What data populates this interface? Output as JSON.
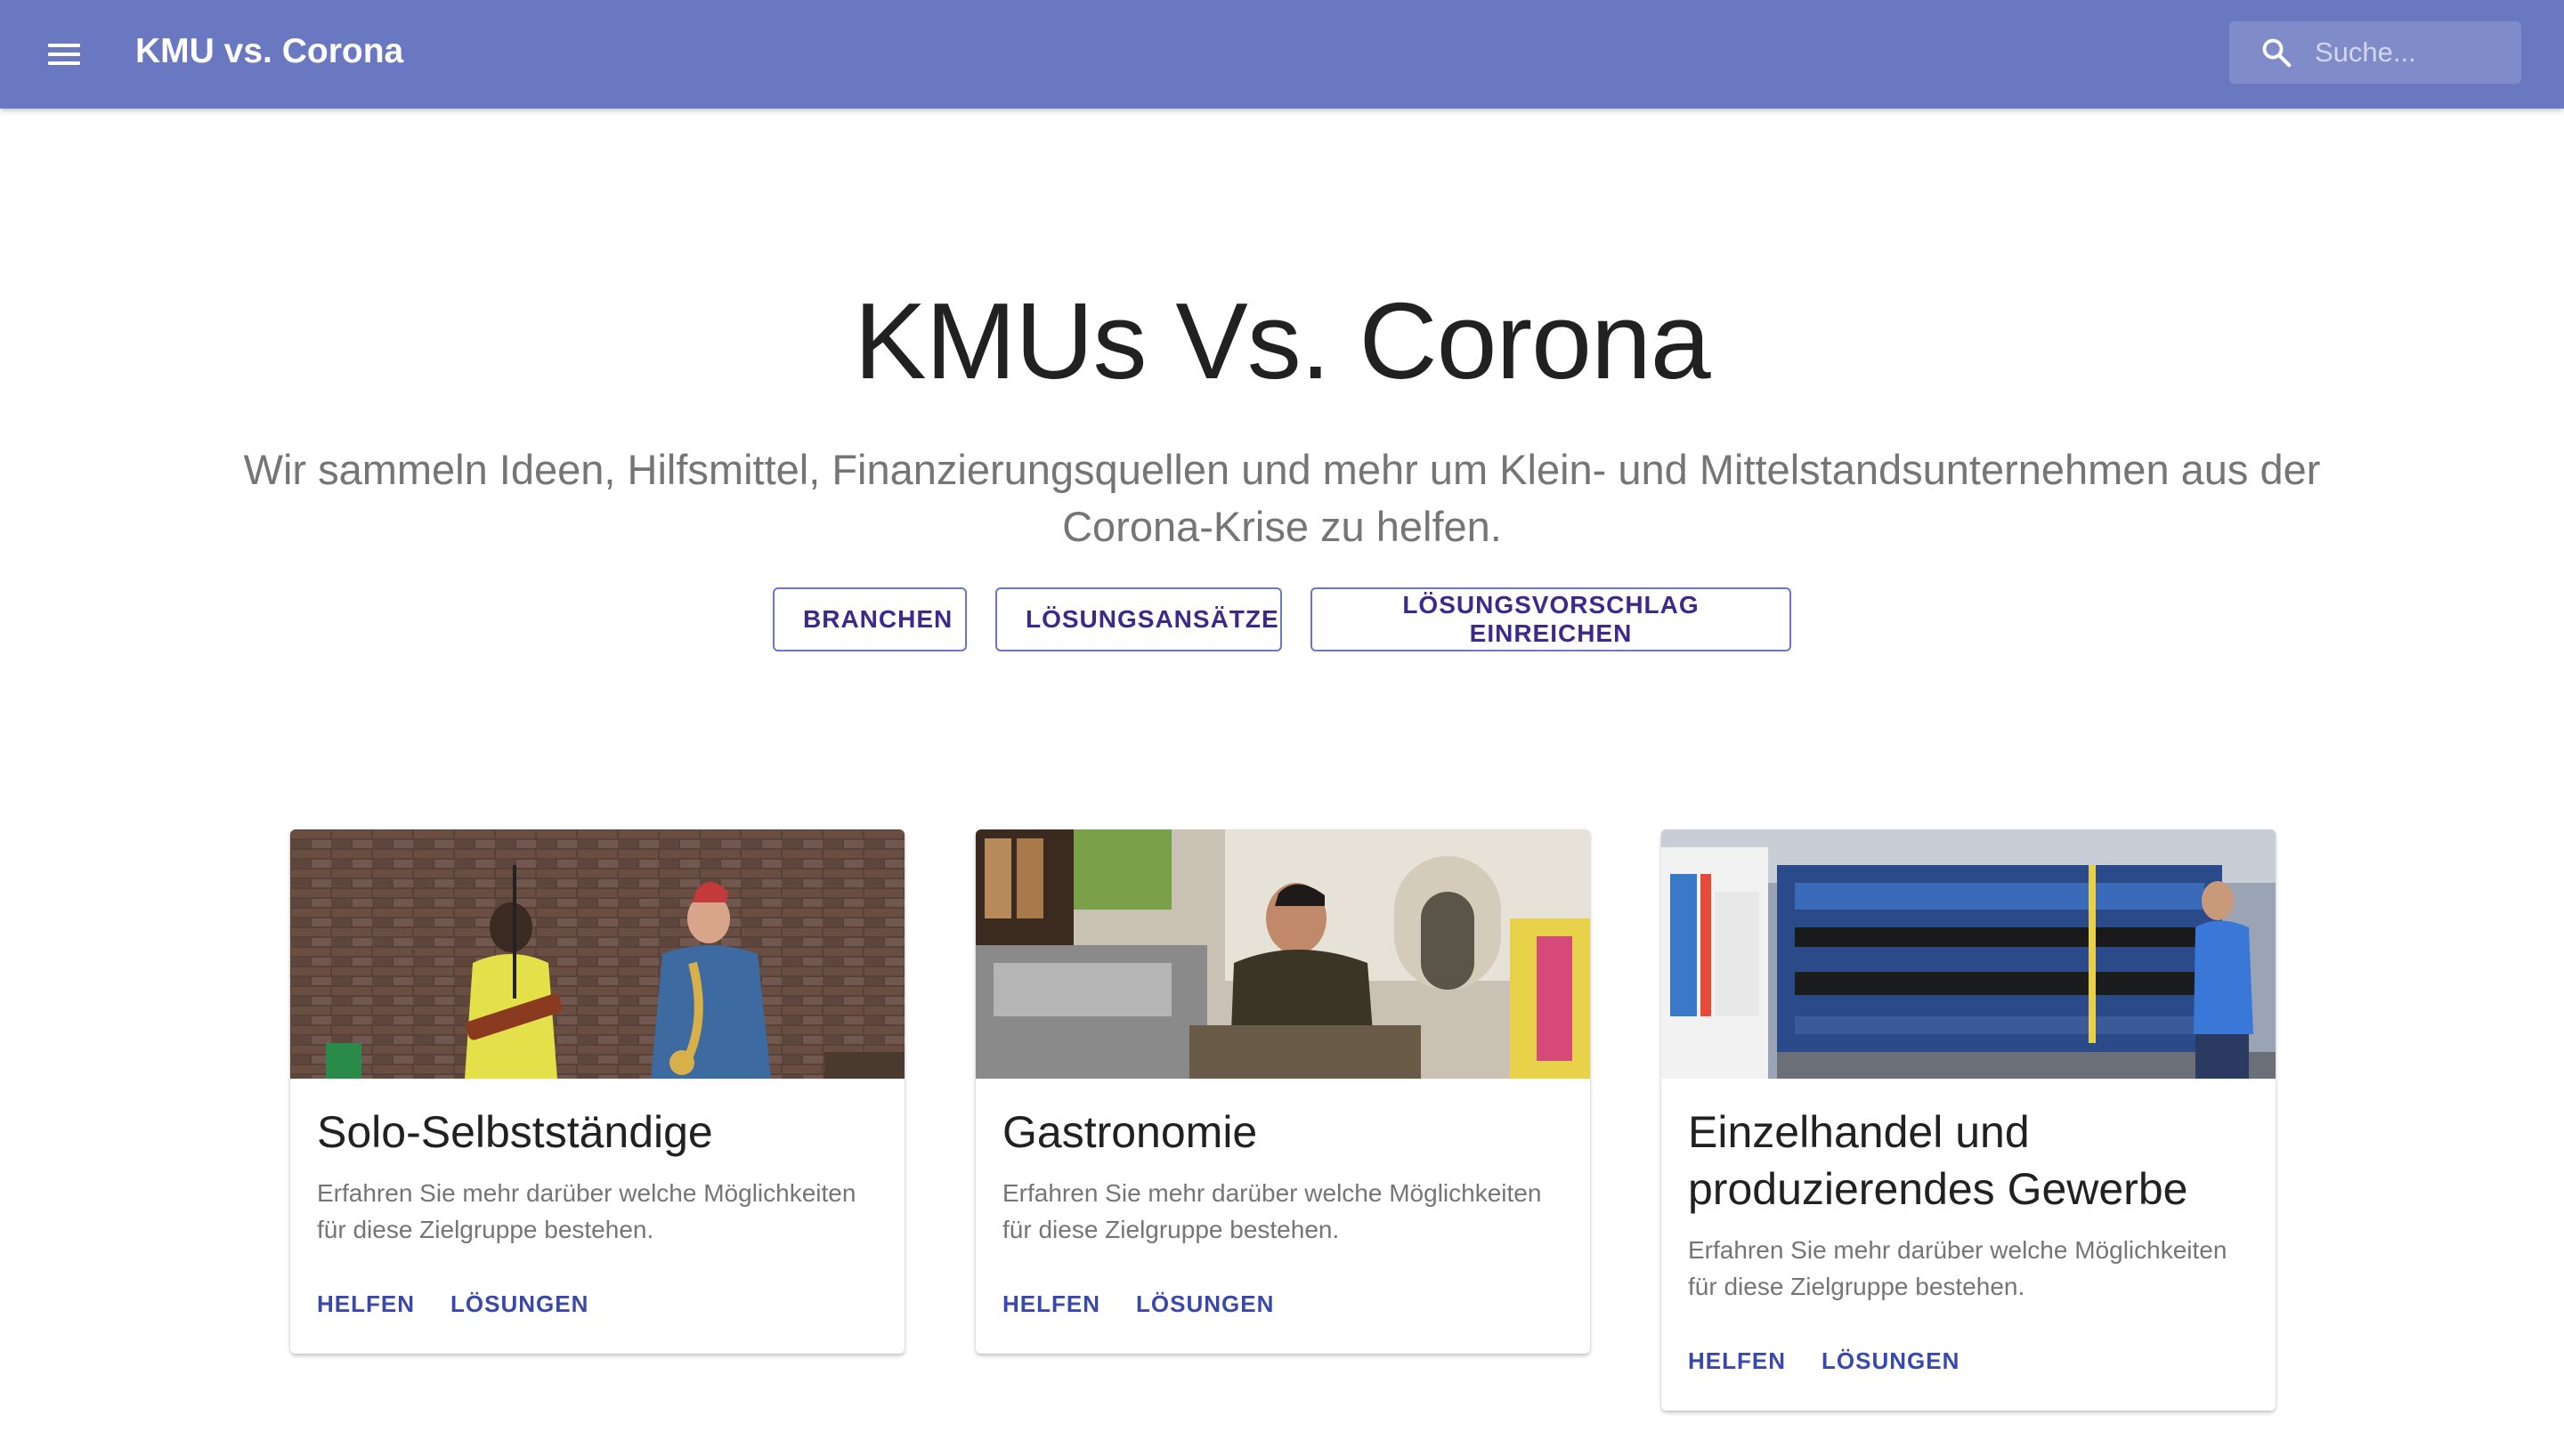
{
  "appbar": {
    "title": "KMU vs. Corona",
    "search_placeholder": "Suche...",
    "background": "#6a77c1"
  },
  "hero": {
    "title": "KMUs Vs. Corona",
    "subtitle": "Wir sammeln Ideen, Hilfsmittel, Finanzierungsquellen und mehr um Klein- und Mittelstandsunternehmen aus der Corona-Krise zu helfen.",
    "buttons": [
      "BRANCHEN",
      "LÖSUNGSANSÄTZE",
      "LÖSUNGSVORSCHLAG EINREICHEN"
    ]
  },
  "cards": [
    {
      "title": "Solo-Selbstständige",
      "text": "Erfahren Sie mehr darüber welche Möglichkeiten für diese Zielgruppe bestehen.",
      "actions": [
        "HELFEN",
        "LÖSUNGEN"
      ],
      "image": "street-musicians-photo"
    },
    {
      "title": "Gastronomie",
      "text": "Erfahren Sie mehr darüber welche Möglichkeiten für diese Zielgruppe bestehen.",
      "actions": [
        "HELFEN",
        "LÖSUNGEN"
      ],
      "image": "barista-photo"
    },
    {
      "title": "Einzelhandel und produzierendes Gewerbe",
      "text": "Erfahren Sie mehr darüber welche Möglichkeiten für diese Zielgruppe bestehen.",
      "actions": [
        "HELFEN",
        "LÖSUNGEN"
      ],
      "image": "factory-machine-photo"
    }
  ],
  "icons": {
    "menu": "menu-icon",
    "search": "search-icon"
  },
  "colors": {
    "accent": "#6a77c1",
    "button_text": "#3a2a8c",
    "card_action": "#3949ab",
    "secondary_text": "#757575"
  }
}
